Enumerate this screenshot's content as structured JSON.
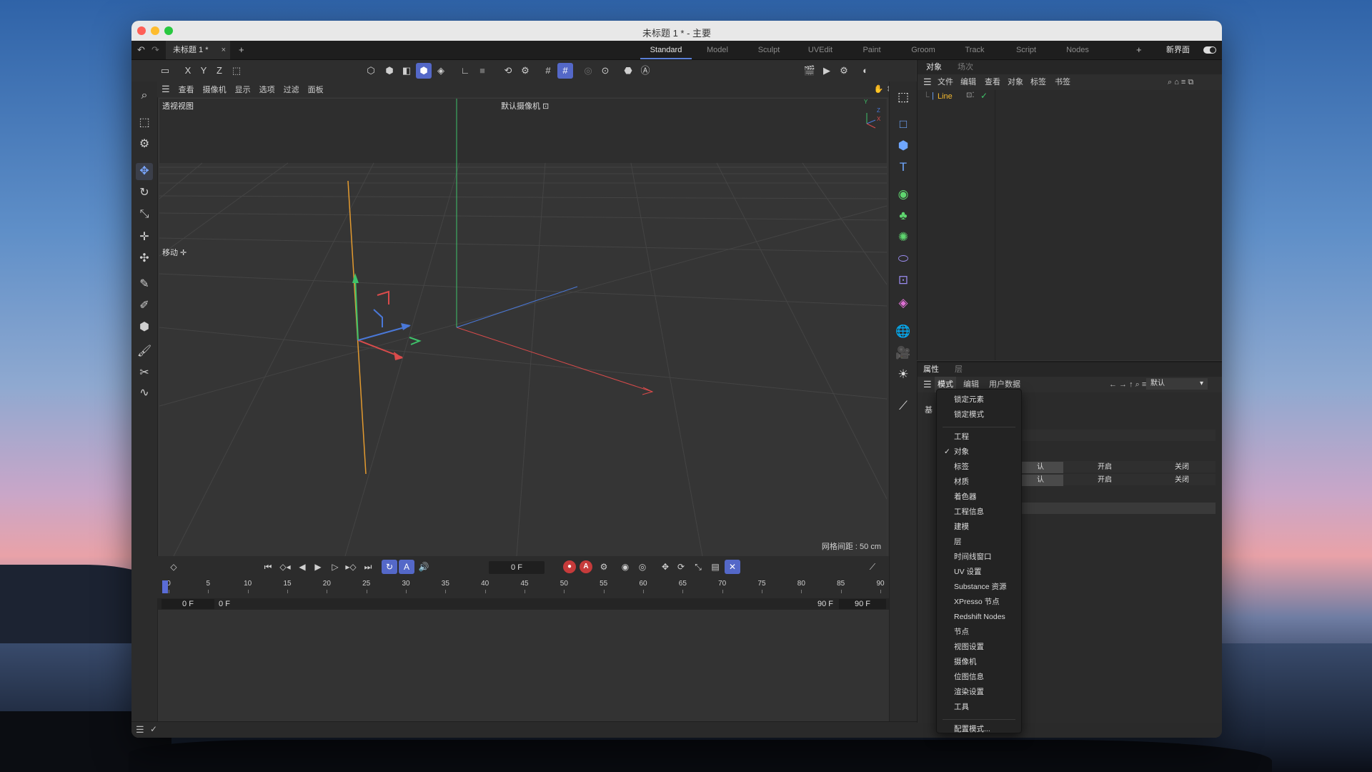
{
  "window": {
    "title": "未标题 1 * - 主要",
    "document_tab": "未标题 1 *",
    "document_tab_close": "×",
    "add_tab": "+"
  },
  "layouts": {
    "items": [
      "Standard",
      "Model",
      "Sculpt",
      "UVEdit",
      "Paint",
      "Groom",
      "Track",
      "Script",
      "Nodes"
    ],
    "active": "Standard",
    "add": "+",
    "new_ui": "新界面"
  },
  "toolbar": {
    "axis_x": "X",
    "axis_y": "Y",
    "axis_z": "Z"
  },
  "viewport": {
    "menu": [
      "查看",
      "摄像机",
      "显示",
      "选项",
      "过滤",
      "面板"
    ],
    "view_name": "透视视图",
    "camera_name": "默认摄像机",
    "tool_hud": "移动",
    "grid_spacing": "网格间距 : 50 cm",
    "axis_y": "Y",
    "axis_z": "Z",
    "axis_x": "X"
  },
  "timeline": {
    "current_frame": "0 F",
    "ruler_labels": [
      "0",
      "5",
      "10",
      "15",
      "20",
      "25",
      "30",
      "35",
      "40",
      "45",
      "50",
      "55",
      "60",
      "65",
      "70",
      "75",
      "80",
      "85",
      "90"
    ],
    "range_start_a": "0 F",
    "range_start_b": "0 F",
    "range_end_a": "90 F",
    "range_end_b": "90 F",
    "record_label": "A"
  },
  "object_manager": {
    "tabs": [
      "对象",
      "场次"
    ],
    "active_tab": "对象",
    "menu": [
      "文件",
      "编辑",
      "查看",
      "对象",
      "标签",
      "书签"
    ],
    "objects": [
      {
        "name": "Line"
      }
    ]
  },
  "attribute_manager": {
    "tabs": [
      "属性",
      "层"
    ],
    "active_tab": "属性",
    "menu": [
      "模式",
      "编辑",
      "用户数据"
    ],
    "default_dropdown": "默认",
    "base_label": "基",
    "row1": {
      "c1": "认",
      "c2": "开启",
      "c3": "关闭"
    },
    "row2": {
      "c1": "认",
      "c2": "开启",
      "c3": "关闭"
    }
  },
  "mode_menu": {
    "items": [
      {
        "label": "锁定元素",
        "checked": false
      },
      {
        "label": "锁定模式",
        "checked": false
      },
      {
        "label": "工程",
        "checked": false
      },
      {
        "label": "对象",
        "checked": true
      },
      {
        "label": "标签",
        "checked": false
      },
      {
        "label": "材质",
        "checked": false
      },
      {
        "label": "着色器",
        "checked": false
      },
      {
        "label": "工程信息",
        "checked": false
      },
      {
        "label": "建模",
        "checked": false
      },
      {
        "label": "层",
        "checked": false
      },
      {
        "label": "时间线窗口",
        "checked": false
      },
      {
        "label": "UV 设置",
        "checked": false
      },
      {
        "label": "Substance 资源",
        "checked": false
      },
      {
        "label": "XPresso 节点",
        "checked": false
      },
      {
        "label": "Redshift Nodes",
        "checked": false
      },
      {
        "label": "节点",
        "checked": false
      },
      {
        "label": "视图设置",
        "checked": false
      },
      {
        "label": "摄像机",
        "checked": false
      },
      {
        "label": "位图信息",
        "checked": false
      },
      {
        "label": "渲染设置",
        "checked": false
      },
      {
        "label": "工具",
        "checked": false
      },
      {
        "label": "配置模式...",
        "checked": false
      }
    ],
    "checkmark": "✓"
  },
  "colors": {
    "accent": "#5468c8",
    "object_name": "#f2b830",
    "x_axis": "#d94b4b",
    "y_axis": "#3fc26a",
    "z_axis": "#4a78d8",
    "spline": "#e39a2f"
  }
}
